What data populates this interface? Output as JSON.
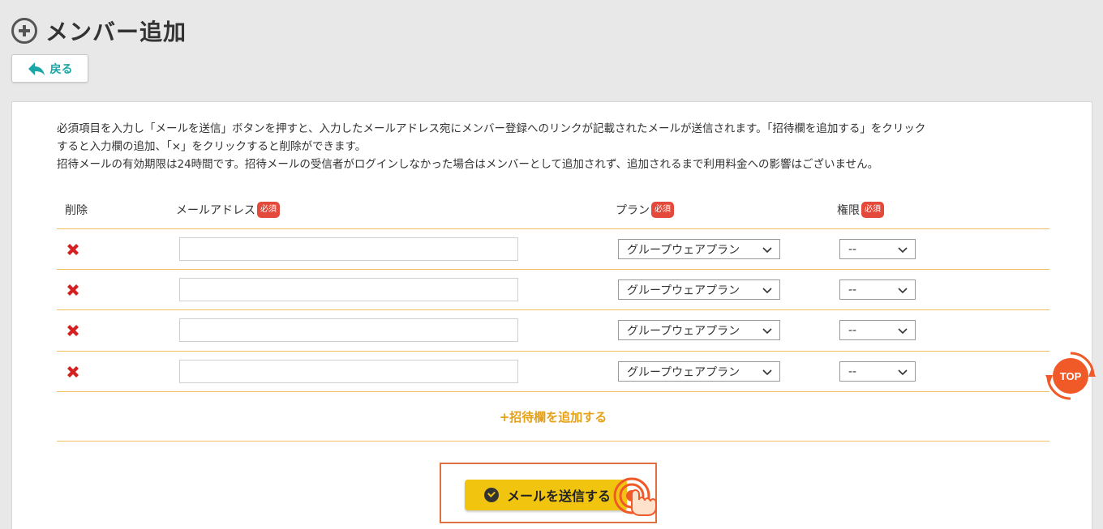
{
  "header": {
    "title": "メンバー追加",
    "icon": "plus-circle-icon"
  },
  "back_button": {
    "label": "戻る",
    "icon": "back-arrow-icon"
  },
  "description": {
    "line1": "必須項目を入力し「メールを送信」ボタンを押すと、入力したメールアドレス宛にメンバー登録へのリンクが記載されたメールが送信されます。「招待欄を追加する」をクリック",
    "line2": "すると入力欄の追加、「×」をクリックすると削除ができます。",
    "line3": "招待メールの有効期限は24時間です。招待メールの受信者がログインしなかった場合はメンバーとして追加されず、追加されるまで利用料金への影響はございません。"
  },
  "columns": {
    "delete": "削除",
    "email": "メールアドレス",
    "plan": "プラン",
    "role": "権限",
    "required_badge": "必須"
  },
  "rows": [
    {
      "email": "",
      "plan": "グループウェアプラン",
      "role": "--"
    },
    {
      "email": "",
      "plan": "グループウェアプラン",
      "role": "--"
    },
    {
      "email": "",
      "plan": "グループウェアプラン",
      "role": "--"
    },
    {
      "email": "",
      "plan": "グループウェアプラン",
      "role": "--"
    }
  ],
  "add_row_label": "+招待欄を追加する",
  "send_button": {
    "label": "メールを送信する",
    "icon": "check-circle-icon"
  },
  "top_button": {
    "label": "TOP"
  },
  "colors": {
    "accent_orange": "#e6a117",
    "delete_red": "#d42020",
    "required_red": "#e44a3b",
    "send_yellow": "#f1c40f",
    "back_teal": "#1aa6a6",
    "top_orange": "#f05a28"
  }
}
